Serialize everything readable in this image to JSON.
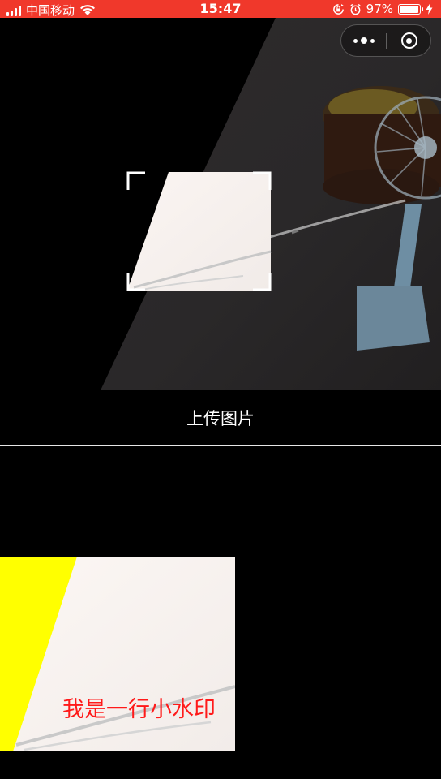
{
  "status_bar": {
    "carrier": "中国移动",
    "time": "15:47",
    "battery": "97%",
    "battery_level": 0.97,
    "icons": [
      "signal-icon",
      "wifi-icon",
      "rotation-lock-icon",
      "alarm-icon",
      "battery-icon",
      "charging-icon"
    ]
  },
  "capsule": {
    "icons": [
      "more-dots-icon",
      "close-target-icon"
    ]
  },
  "camera": {
    "frame_icon": "scan-corner-frame"
  },
  "upload": {
    "label": "上传图片"
  },
  "result": {
    "watermark": "我是一行小水印"
  },
  "colors": {
    "status_bar_bg": "#f0382b",
    "watermark_text": "#ff1a1a",
    "highlight_yellow": "#ffff00",
    "background": "#000000"
  }
}
